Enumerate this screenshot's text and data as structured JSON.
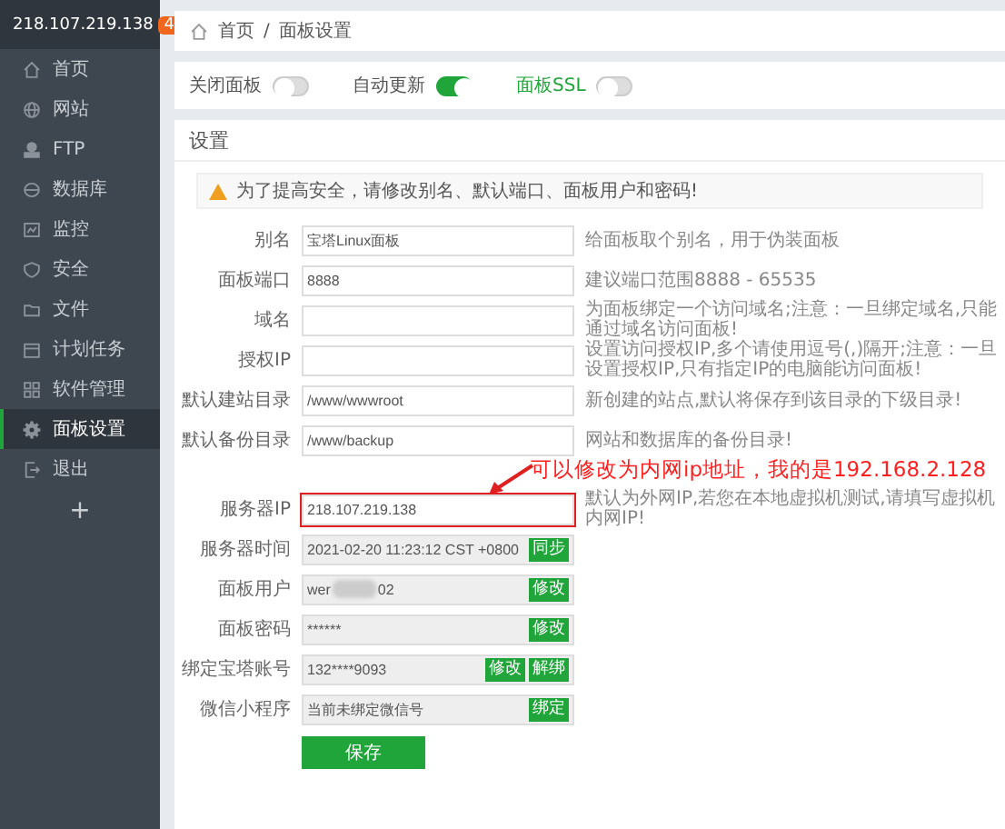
{
  "sidebar": {
    "host": "218.107.219.138",
    "badge": "4",
    "items": [
      {
        "label": "首页",
        "selected": false
      },
      {
        "label": "网站",
        "selected": false
      },
      {
        "label": "FTP",
        "selected": false
      },
      {
        "label": "数据库",
        "selected": false
      },
      {
        "label": "监控",
        "selected": false
      },
      {
        "label": "安全",
        "selected": false
      },
      {
        "label": "文件",
        "selected": false
      },
      {
        "label": "计划任务",
        "selected": false
      },
      {
        "label": "软件管理",
        "selected": false
      },
      {
        "label": "面板设置",
        "selected": true
      },
      {
        "label": "退出",
        "selected": false
      }
    ],
    "add": "+"
  },
  "breadcrumb": [
    "首页",
    "/",
    "面板设置"
  ],
  "toggles": [
    {
      "label": "关闭面板",
      "on": false,
      "link": false
    },
    {
      "label": "自动更新",
      "on": true,
      "link": false
    },
    {
      "label": "面板SSL",
      "on": false,
      "link": true
    }
  ],
  "settings": {
    "title": "设置",
    "warning": "为了提高安全，请修改别名、默认端口、面板用户和密码!",
    "rows": [
      {
        "label": "别名",
        "value": "宝塔Linux面板",
        "readonly": false,
        "highlighted": false,
        "hint": "给面板取个别名，用于伪装面板",
        "buttons": []
      },
      {
        "label": "面板端口",
        "value": "8888",
        "readonly": false,
        "highlighted": false,
        "hint": "建议端口范围8888 - 65535",
        "buttons": []
      },
      {
        "label": "域名",
        "readonly": false,
        "highlighted": false,
        "hint": "为面板绑定一个访问域名;注意：一旦绑定域名,只能通过域名访问面板!",
        "buttons": []
      },
      {
        "label": "授权IP",
        "readonly": false,
        "highlighted": false,
        "hint": "设置访问授权IP,多个请使用逗号(,)隔开;注意：一旦设置授权IP,只有指定IP的电脑能访问面板!",
        "buttons": []
      },
      {
        "label": "默认建站目录",
        "value": "/www/wwwroot",
        "readonly": false,
        "highlighted": false,
        "hint": "新创建的站点,默认将保存到该目录的下级目录!",
        "buttons": []
      },
      {
        "label": "默认备份目录",
        "value": "/www/backup",
        "readonly": false,
        "highlighted": false,
        "hint": "网站和数据库的备份目录!",
        "buttons": []
      },
      {
        "label": "服务器IP",
        "value": "218.107.219.138",
        "readonly": false,
        "highlighted": true,
        "annotation": "可以修改为内网ip地址，我的是192.168.2.128",
        "hint": "默认为外网IP,若您在本地虚拟机测试,请填写虚拟机内网IP!",
        "buttons": []
      },
      {
        "label": "服务器时间",
        "value": "2021-02-20 11:23:12 CST +0800",
        "readonly": true,
        "highlighted": false,
        "buttons": [
          "同步"
        ]
      },
      {
        "label": "面板用户",
        "value": "wer",
        "value_end": "02",
        "readonly": true,
        "highlighted": false,
        "buttons": [
          "修改"
        ]
      },
      {
        "label": "面板密码",
        "value": "******",
        "readonly": true,
        "highlighted": false,
        "buttons": [
          "修改"
        ]
      },
      {
        "label": "绑定宝塔账号",
        "value": "132****9093",
        "readonly": true,
        "highlighted": false,
        "buttons": [
          "修改",
          "解绑"
        ]
      },
      {
        "label": "微信小程序",
        "value": "当前未绑定微信号",
        "readonly": true,
        "highlighted": false,
        "buttons": [
          "绑定"
        ]
      }
    ],
    "save": "保存"
  }
}
